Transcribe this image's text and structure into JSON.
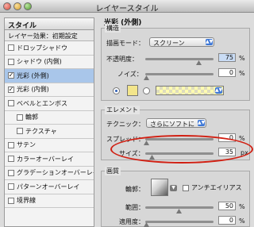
{
  "window": {
    "title": "レイヤースタイル"
  },
  "sidebar": {
    "header": "スタイル",
    "subheader": "レイヤー効果：初期設定",
    "items": [
      {
        "label": "ドロップシャドウ",
        "checked": false,
        "selected": false
      },
      {
        "label": "シャドウ (内側)",
        "checked": false,
        "selected": false
      },
      {
        "label": "光彩 (外側)",
        "checked": true,
        "selected": true
      },
      {
        "label": "光彩 (内側)",
        "checked": true,
        "selected": false
      },
      {
        "label": "ベベルとエンボス",
        "checked": false,
        "selected": false
      },
      {
        "label": "輪郭",
        "checked": false,
        "selected": false,
        "sub": true
      },
      {
        "label": "テクスチャ",
        "checked": false,
        "selected": false,
        "sub": true
      },
      {
        "label": "サテン",
        "checked": false,
        "selected": false
      },
      {
        "label": "カラーオーバーレイ",
        "checked": false,
        "selected": false
      },
      {
        "label": "グラデーションオーバーレイ",
        "checked": false,
        "selected": false
      },
      {
        "label": "パターンオーバーレイ",
        "checked": false,
        "selected": false
      },
      {
        "label": "境界線",
        "checked": false,
        "selected": false
      }
    ]
  },
  "panel": {
    "title": "光彩 (外側)",
    "structure": {
      "title": "構造",
      "blend_label": "描画モード：",
      "blend_value": "スクリーン",
      "opacity_label": "不透明度：",
      "opacity_value": "75",
      "opacity_unit": "%",
      "noise_label": "ノイズ：",
      "noise_value": "0",
      "noise_unit": "%",
      "glow_color": "#f3e58b"
    },
    "elements": {
      "title": "エレメント",
      "technique_label": "テクニック：",
      "technique_value": "さらにソフトに",
      "spread_label": "スプレッド：",
      "spread_value": "0",
      "spread_unit": "%",
      "size_label": "サイズ：",
      "size_value": "35",
      "size_unit": "px"
    },
    "quality": {
      "title": "画質",
      "contour_label": "輪郭：",
      "antialias_label": "アンチエイリアス",
      "range_label": "範囲：",
      "range_value": "50",
      "range_unit": "%",
      "jitter_label": "適用度：",
      "jitter_value": "0",
      "jitter_unit": "%"
    }
  },
  "annotation": {
    "highlight_color": "#d11f12"
  }
}
